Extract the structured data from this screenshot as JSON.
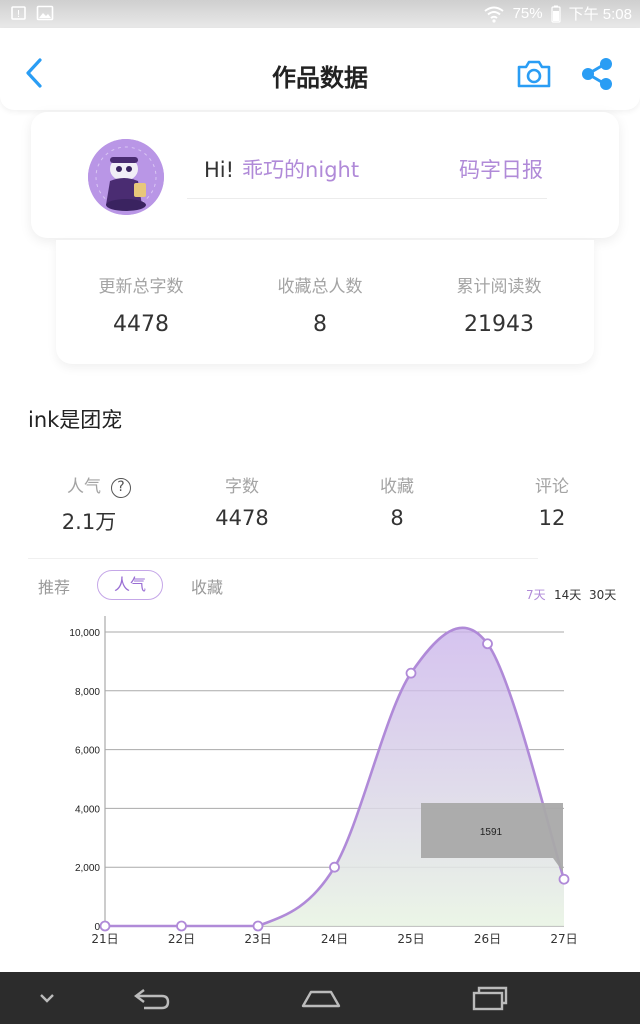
{
  "status_bar": {
    "battery": "75%",
    "time": "下午 5:08",
    "icons": [
      "storage-warning-icon",
      "image-icon",
      "wifi-icon",
      "battery-icon"
    ]
  },
  "header": {
    "title": "作品数据",
    "back_icon": "chevron-left-icon",
    "camera_icon": "camera-icon",
    "share_icon": "share-icon",
    "accent_color": "#2a9df4"
  },
  "profile": {
    "greeting": "Hi!",
    "username": "乖巧的night",
    "daily_report": "码字日报",
    "accent_color": "#b08ad8"
  },
  "summary_stats": [
    {
      "label": "更新总字数",
      "value": "4478"
    },
    {
      "label": "收藏总人数",
      "value": "8"
    },
    {
      "label": "累计阅读数",
      "value": "21943"
    }
  ],
  "work": {
    "title": "ink是团宠",
    "stats": [
      {
        "label": "人气",
        "value": "2.1万"
      },
      {
        "label": "字数",
        "value": "4478"
      },
      {
        "label": "收藏",
        "value": "8"
      },
      {
        "label": "评论",
        "value": "12"
      }
    ],
    "help_icon": "?"
  },
  "tabs": {
    "recommend": "推荐",
    "popularity": "人气",
    "collect": "收藏",
    "active": "人气"
  },
  "ranges": {
    "d7": "7天",
    "d14": "14天",
    "d30": "30天",
    "active": "7天"
  },
  "chart_data": {
    "type": "area",
    "categories": [
      "21日",
      "22日",
      "23日",
      "24日",
      "25日",
      "26日",
      "27日"
    ],
    "values": [
      0,
      0,
      0,
      2000,
      8600,
      9600,
      1591
    ],
    "ylim": [
      0,
      10000
    ],
    "yticks": [
      "0",
      "2,000",
      "4,000",
      "6,000",
      "8,000",
      "10,000"
    ],
    "tooltip": "1591",
    "line_color": "#b08ad8",
    "grid": true
  },
  "nav": {
    "icons": [
      "chevron-down-icon",
      "back-icon",
      "home-icon",
      "recents-icon"
    ]
  }
}
